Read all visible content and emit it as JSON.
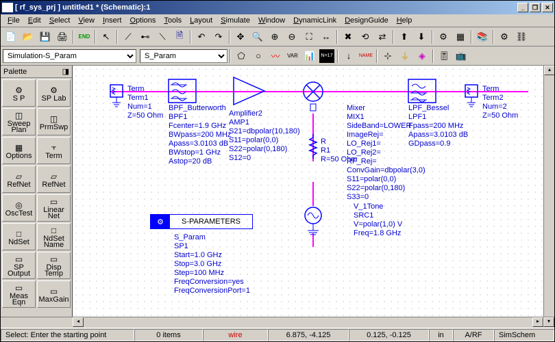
{
  "title": "[ rf_sys_prj ] untitled1 * (Schematic):1",
  "menu": [
    "File",
    "Edit",
    "Select",
    "View",
    "Insert",
    "Options",
    "Tools",
    "Layout",
    "Simulate",
    "Window",
    "DynamicLink",
    "DesignGuide",
    "Help"
  ],
  "dropdown1": "Simulation-S_Param",
  "dropdown2": "S_Param",
  "palette_title": "Palette",
  "palette": [
    {
      "label": "S P",
      "icon": "⚙"
    },
    {
      "label": "SP Lab",
      "icon": "⚙"
    },
    {
      "label": "Sweep\nPlan",
      "icon": "◫"
    },
    {
      "label": "PrmSwp",
      "icon": "◫"
    },
    {
      "label": "Options",
      "icon": "▦"
    },
    {
      "label": "Term",
      "icon": "⫟"
    },
    {
      "label": "RefNet",
      "icon": "▱"
    },
    {
      "label": "RefNet",
      "icon": "▱"
    },
    {
      "label": "OscTest",
      "icon": "◎"
    },
    {
      "label": "Linear\nNet",
      "icon": "▭"
    },
    {
      "label": "NdSet",
      "icon": "□"
    },
    {
      "label": "NdSet\nName",
      "icon": "□"
    },
    {
      "label": "SP\nOutput",
      "icon": "▭"
    },
    {
      "label": "Disp\nTemp",
      "icon": "▭"
    },
    {
      "label": "Meas\nEqn",
      "icon": "▭"
    },
    {
      "label": "MaxGain",
      "icon": "▭"
    }
  ],
  "components": {
    "term1": {
      "name": "Term",
      "inst": "Term1",
      "p": [
        "Num=1",
        "Z=50 Ohm"
      ]
    },
    "term2": {
      "name": "Term",
      "inst": "Term2",
      "p": [
        "Num=2",
        "Z=50 Ohm"
      ]
    },
    "bpf": {
      "name": "BPF_Butterworth",
      "inst": "BPF1",
      "p": [
        "Fcenter=1.9 GHz",
        "BWpass=200 MHz",
        "Apass=3.0103 dB",
        "BWstop=1 GHz",
        "Astop=20 dB"
      ]
    },
    "amp": {
      "name": "Amplifier2",
      "inst": "AMP1",
      "p": [
        "S21=dbpolar(10,180)",
        "S11=polar(0,0)",
        "S22=polar(0,180)",
        "S12=0"
      ]
    },
    "mixer": {
      "name": "Mixer",
      "inst": "MIX1",
      "p": [
        "SideBand=LOWER",
        "ImageRej=",
        "LO_Rej1=",
        "LO_Rej2=",
        "RF_Rej=",
        "ConvGain=dbpolar(3,0)",
        "S11=polar(0,0)",
        "S22=polar(0,180)",
        "S33=0"
      ]
    },
    "lpf": {
      "name": "LPF_Bessel",
      "inst": "LPF1",
      "p": [
        "Fpass=200 MHz",
        "Apass=3.0103 dB",
        "GDpass=0.9"
      ]
    },
    "r1": {
      "name": "R",
      "inst": "R1",
      "p": [
        "R=50 Ohm"
      ]
    },
    "src": {
      "name": "V_1Tone",
      "inst": "SRC1",
      "p": [
        "V=polar(1,0) V",
        "Freq=1.8 GHz"
      ]
    },
    "sparam_box": "S-PARAMETERS",
    "sparam": {
      "name": "S_Param",
      "inst": "SP1",
      "p": [
        "Start=1.0 GHz",
        "Stop=3.0 GHz",
        "Step=100 MHz",
        "FreqConversion=yes",
        "FreqConversionPort=1"
      ]
    }
  },
  "status": {
    "hint": "Select: Enter the starting point",
    "items": "0 items",
    "mode": "wire",
    "coord1": "6.875, -4.125",
    "coord2": "0.125, -0.125",
    "unit": "in",
    "layer": "A/RF",
    "sim": "SimSchem"
  }
}
